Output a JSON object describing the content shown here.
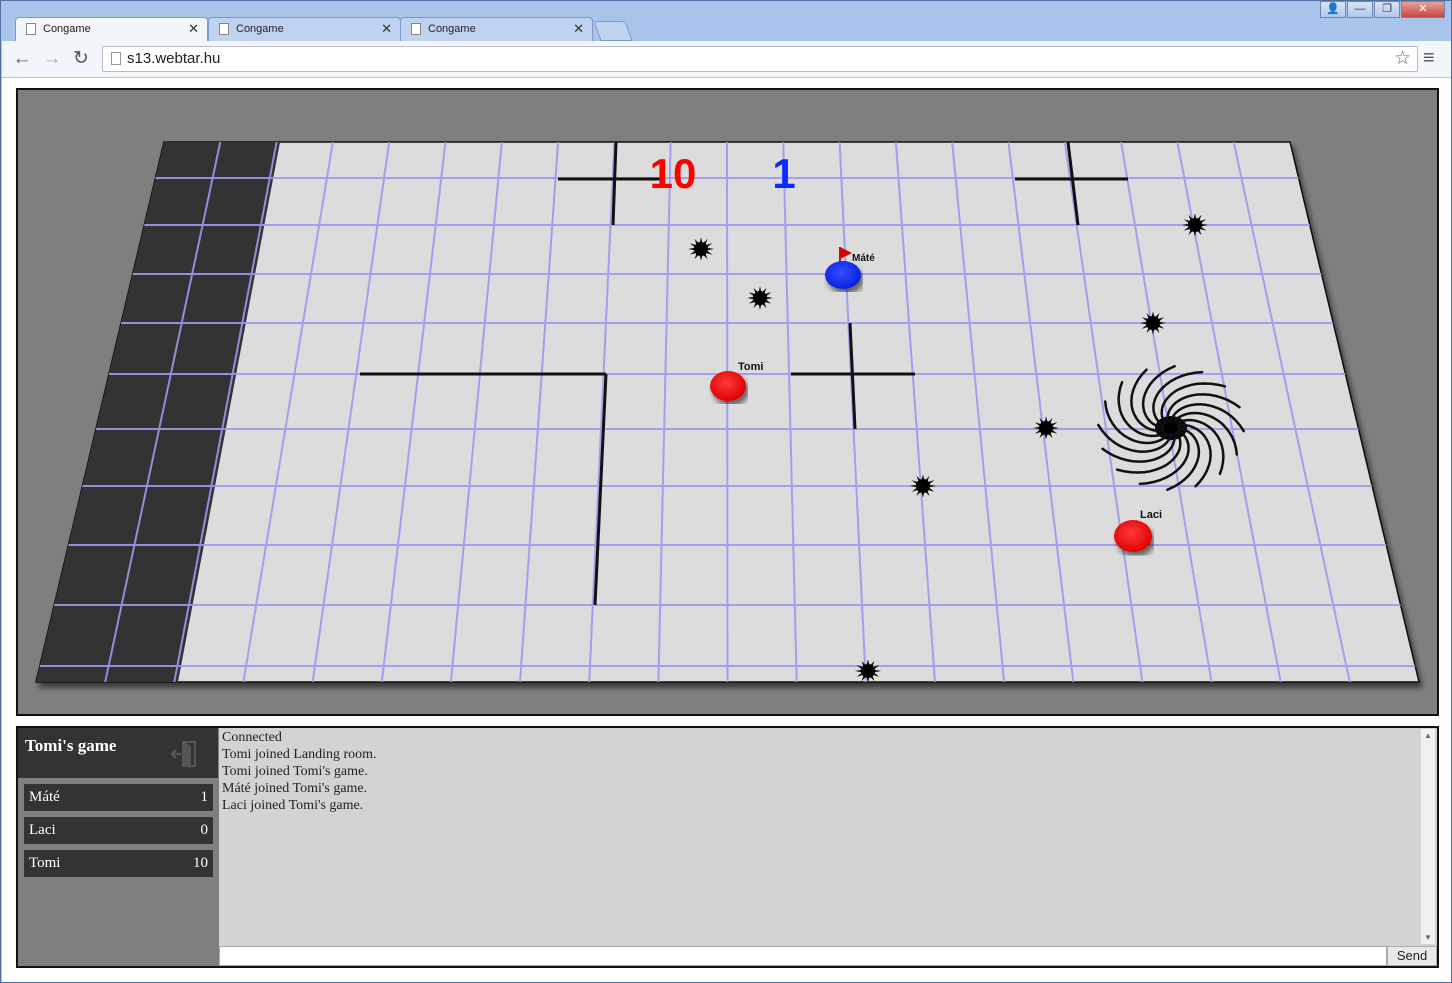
{
  "browser": {
    "tabs": [
      {
        "title": "Congame",
        "active": true
      },
      {
        "title": "Congame",
        "active": false
      },
      {
        "title": "Congame",
        "active": false
      }
    ],
    "url": "s13.webtar.hu",
    "window_buttons": {
      "user": "👤",
      "minimize": "—",
      "maximize": "❐",
      "close": "✕"
    }
  },
  "game": {
    "score_red": "10",
    "score_blue": "1",
    "players_on_field": [
      {
        "name": "Máté",
        "team": "blue",
        "has_flag": true
      },
      {
        "name": "Tomi",
        "team": "red",
        "has_flag": false
      },
      {
        "name": "Laci",
        "team": "red",
        "has_flag": false
      }
    ],
    "colors": {
      "red_team": "#ff0000",
      "blue_team": "#0a2bff",
      "board": "#dcdcdc",
      "grid": "#9a9af0",
      "background": "#7f7f7f"
    }
  },
  "room": {
    "title": "Tomi's game",
    "players": [
      {
        "name": "Máté",
        "score": "1"
      },
      {
        "name": "Laci",
        "score": "0"
      },
      {
        "name": "Tomi",
        "score": "10"
      }
    ]
  },
  "chat": {
    "messages": [
      "Connected",
      "Tomi joined Landing room.",
      "Tomi joined Tomi's game.",
      "Máté joined Tomi's game.",
      "Laci joined Tomi's game."
    ],
    "input_value": "",
    "send_label": "Send"
  }
}
